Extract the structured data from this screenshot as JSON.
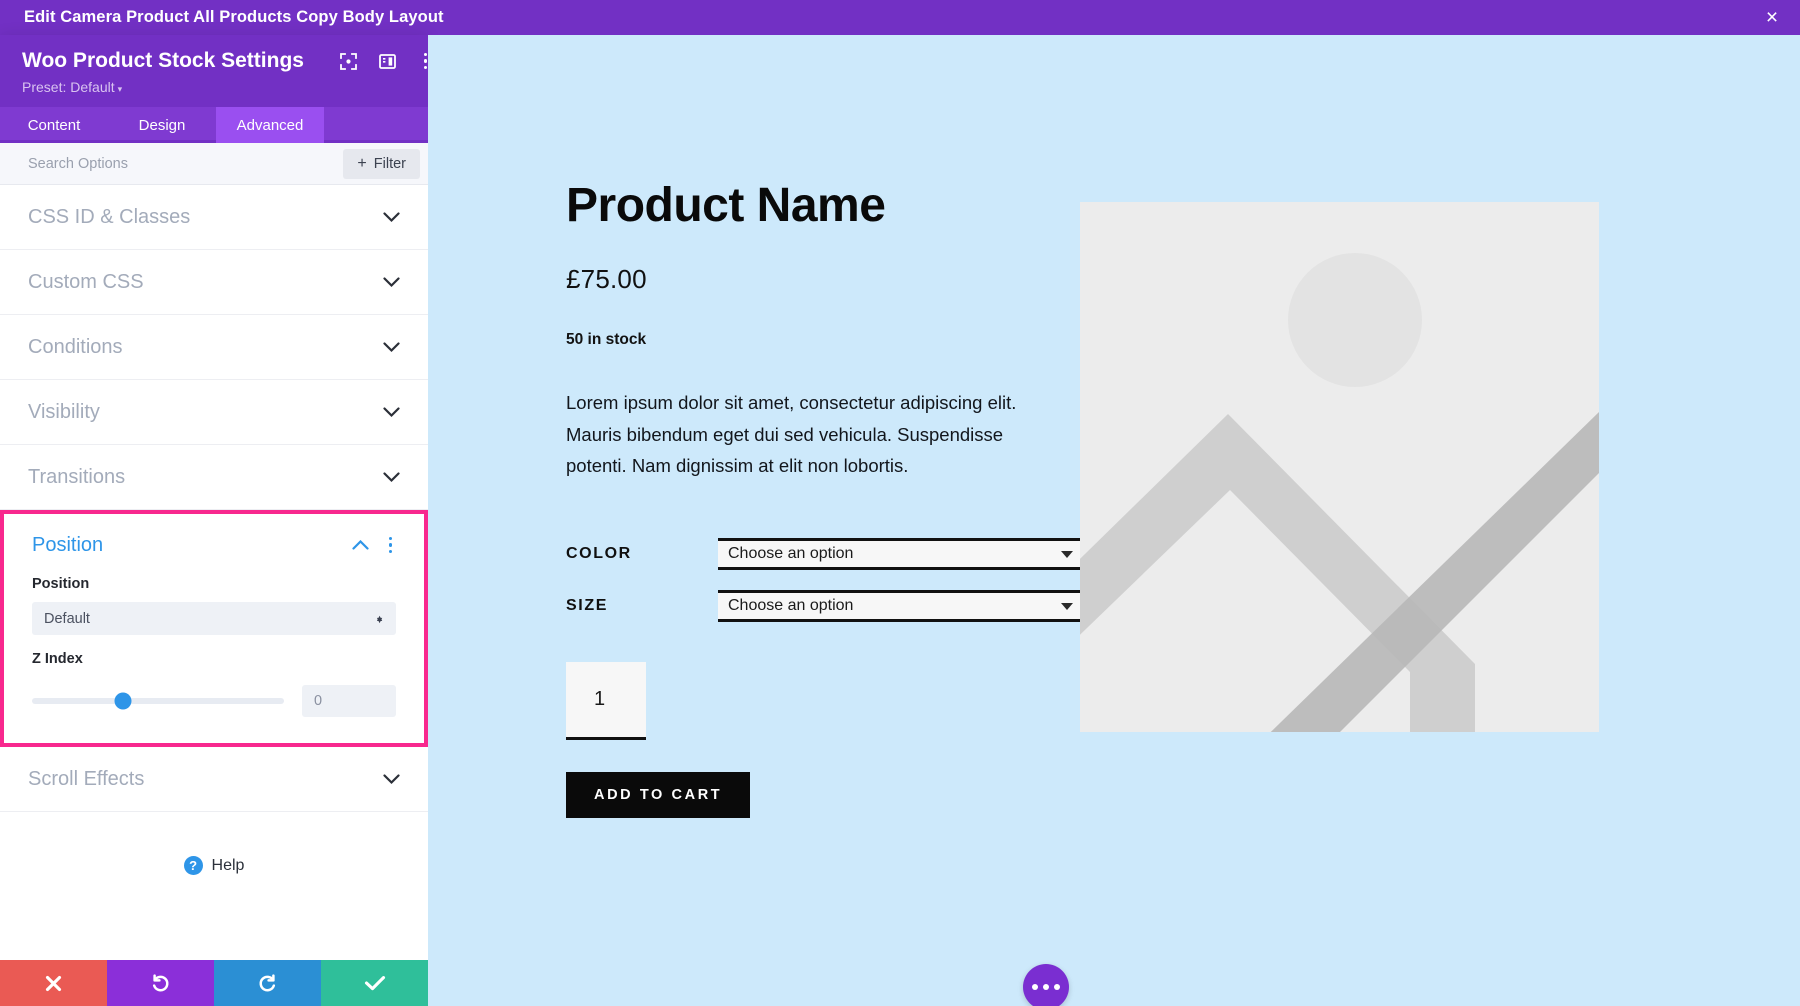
{
  "topbar": {
    "title": "Edit Camera Product All Products Copy Body Layout",
    "close_label": "×"
  },
  "panel": {
    "title": "Woo Product Stock Settings",
    "preset_label": "Preset: Default",
    "preset_caret": "▾",
    "icons": [
      "focus-target-icon",
      "split-view-icon",
      "more-options-icon"
    ],
    "tabs": [
      {
        "label": "Content",
        "active": false
      },
      {
        "label": "Design",
        "active": false
      },
      {
        "label": "Advanced",
        "active": true
      }
    ],
    "search": {
      "placeholder": "Search Options",
      "value": "",
      "filter_label": "Filter",
      "filter_plus": "+"
    },
    "sections": [
      {
        "label": "CSS ID & Classes"
      },
      {
        "label": "Custom CSS"
      },
      {
        "label": "Conditions"
      },
      {
        "label": "Visibility"
      },
      {
        "label": "Transitions"
      }
    ],
    "position_section": {
      "title": "Position",
      "highlight_color": "#f8288e",
      "accent_color": "#2e95e8",
      "position_field": {
        "label": "Position",
        "value": "Default"
      },
      "zindex_field": {
        "label": "Z Index",
        "value": "",
        "placeholder": "0",
        "slider_percent": 36
      }
    },
    "sections_after": [
      {
        "label": "Scroll Effects"
      }
    ],
    "help_label": "Help",
    "help_badge": "?",
    "actions": [
      {
        "name": "cancel",
        "color": "#ea5a54"
      },
      {
        "name": "undo",
        "color": "#8b2fd9"
      },
      {
        "name": "redo",
        "color": "#2b8fd4"
      },
      {
        "name": "save",
        "color": "#2fbf9a"
      }
    ]
  },
  "preview": {
    "background_color": "#cde9fb",
    "product": {
      "name": "Product Name",
      "price": "£75.00",
      "stock": "50 in stock",
      "description": "Lorem ipsum dolor sit amet, consectetur adipiscing elit. Mauris bibendum eget dui sed vehicula. Suspendisse potenti. Nam dignissim at elit non lobortis.",
      "attributes": [
        {
          "label": "COLOR",
          "value": "Choose an option"
        },
        {
          "label": "SIZE",
          "value": "Choose an option"
        }
      ],
      "quantity": "1",
      "add_to_cart_label": "ADD TO CART"
    },
    "fab_label": "more-actions"
  }
}
